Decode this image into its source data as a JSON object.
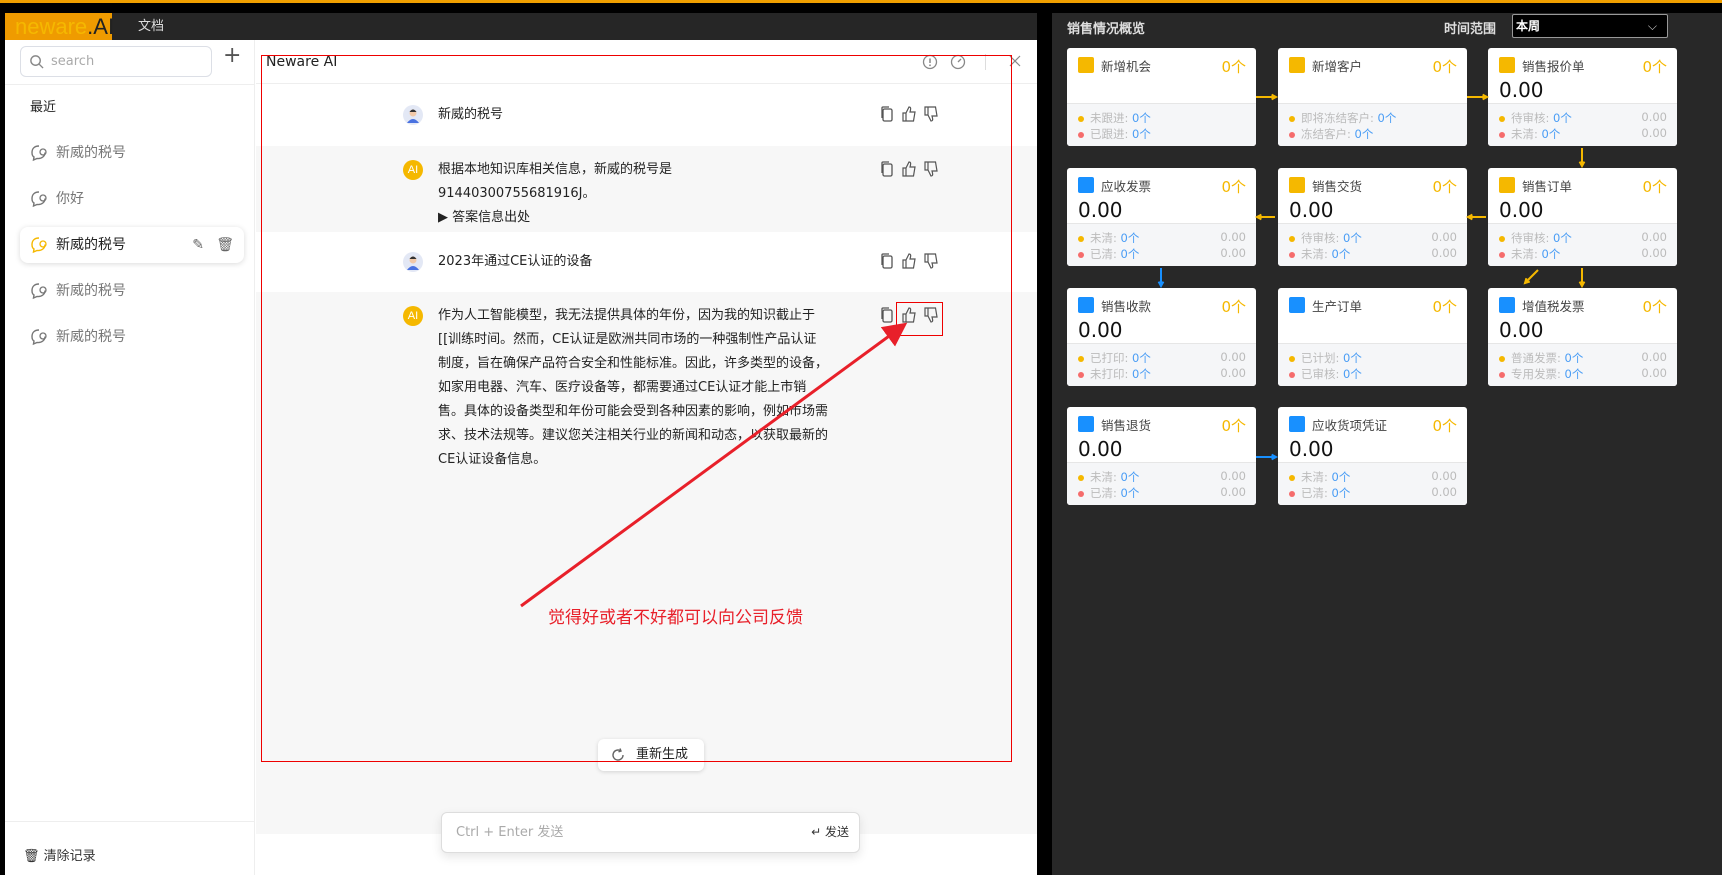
{
  "colors": {
    "accent": "#f0a000",
    "yellow": "#f5b800",
    "blue": "#1890ff",
    "annotation_red": "#e8202a",
    "link_blue": "#4a9df5"
  },
  "app": {
    "logo": {
      "part1": "neware",
      "part2": ".AI"
    },
    "nav_docs": "文档"
  },
  "sidebar": {
    "search_placeholder": "search",
    "recent_header": "最近",
    "items": [
      {
        "label": "新威的税号"
      },
      {
        "label": "你好"
      },
      {
        "label": "新威的税号",
        "active": true
      },
      {
        "label": "新威的税号"
      },
      {
        "label": "新威的税号"
      }
    ],
    "clear_label": "清除记录"
  },
  "chat": {
    "title": "Neware AI",
    "header_icons": [
      "info-icon",
      "clock-icon",
      "close-icon"
    ],
    "messages": [
      {
        "role": "user",
        "text": "新威的税号"
      },
      {
        "role": "ai",
        "avatar": "AI",
        "text": "根据本地知识库相关信息，新威的税号是91440300755681916J。",
        "source_toggle": "答案信息出处"
      },
      {
        "role": "user",
        "text": "2023年通过CE认证的设备"
      },
      {
        "role": "ai",
        "avatar": "AI",
        "text": "作为人工智能模型，我无法提供具体的年份，因为我的知识截止于[[训练时间。然而，CE认证是欧洲共同市场的一种强制性产品认证制度，旨在确保产品符合安全和性能标准。因此，许多类型的设备，如家用电器、汽车、医疗设备等，都需要通过CE认证才能上市销售。具体的设备类型和年份可能会受到各种因素的影响，例如市场需求、技术法规等。建议您关注相关行业的新闻和动态，以获取最新的CE认证设备信息。"
      }
    ],
    "regenerate_label": "重新生成",
    "input_placeholder": "Ctrl + Enter 发送",
    "send_label": "↵ 发送"
  },
  "annotation": {
    "text": "觉得好或者不好都可以向公司反馈"
  },
  "dashboard": {
    "title": "销售情况概览",
    "time_range_label": "时间范围",
    "time_range_value": "本周",
    "cards": [
      {
        "title": "新增机会",
        "count": "0个",
        "icon_color": "#f5b800",
        "lines": [
          {
            "label": "未跟进:",
            "value": "0个"
          },
          {
            "label": "已跟进:",
            "value": "0个"
          }
        ]
      },
      {
        "title": "新增客户",
        "count": "0个",
        "icon_color": "#f5b800",
        "lines": [
          {
            "label": "即将冻结客户:",
            "value": "0个"
          },
          {
            "label": "冻结客户:",
            "value": "0个"
          }
        ]
      },
      {
        "title": "销售报价单",
        "count": "0个",
        "amount": "0.00",
        "icon_color": "#f5b800",
        "lines": [
          {
            "label": "待审核:",
            "value": "0个",
            "amount": "0.00"
          },
          {
            "label": "未清:",
            "value": "0个",
            "amount": "0.00"
          }
        ]
      },
      {
        "title": "应收发票",
        "count": "0个",
        "amount": "0.00",
        "icon_color": "#1890ff",
        "lines": [
          {
            "label": "未清:",
            "value": "0个",
            "amount": "0.00"
          },
          {
            "label": "已清:",
            "value": "0个",
            "amount": "0.00"
          }
        ]
      },
      {
        "title": "销售交货",
        "count": "0个",
        "amount": "0.00",
        "icon_color": "#f5b800",
        "lines": [
          {
            "label": "待审核:",
            "value": "0个",
            "amount": "0.00"
          },
          {
            "label": "未清:",
            "value": "0个",
            "amount": "0.00"
          }
        ]
      },
      {
        "title": "销售订单",
        "count": "0个",
        "amount": "0.00",
        "icon_color": "#f5b800",
        "lines": [
          {
            "label": "待审核:",
            "value": "0个",
            "amount": "0.00"
          },
          {
            "label": "未清:",
            "value": "0个",
            "amount": "0.00"
          }
        ]
      },
      {
        "title": "销售收款",
        "count": "0个",
        "amount": "0.00",
        "icon_color": "#1890ff",
        "lines": [
          {
            "label": "已打印:",
            "value": "0个",
            "amount": "0.00"
          },
          {
            "label": "未打印:",
            "value": "0个",
            "amount": "0.00"
          }
        ]
      },
      {
        "title": "生产订单",
        "count": "0个",
        "icon_color": "#1890ff",
        "lines": [
          {
            "label": "已计划:",
            "value": "0个"
          },
          {
            "label": "已审核:",
            "value": "0个"
          }
        ]
      },
      {
        "title": "增值税发票",
        "count": "0个",
        "amount": "0.00",
        "icon_color": "#1890ff",
        "lines": [
          {
            "label": "普通发票:",
            "value": "0个",
            "amount": "0.00"
          },
          {
            "label": "专用发票:",
            "value": "0个",
            "amount": "0.00"
          }
        ]
      },
      {
        "title": "销售退货",
        "count": "0个",
        "amount": "0.00",
        "icon_color": "#1890ff",
        "lines": [
          {
            "label": "未清:",
            "value": "0个",
            "amount": "0.00"
          },
          {
            "label": "已清:",
            "value": "0个",
            "amount": "0.00"
          }
        ]
      },
      {
        "title": "应收货项凭证",
        "count": "0个",
        "amount": "0.00",
        "icon_color": "#1890ff",
        "lines": [
          {
            "label": "未清:",
            "value": "0个",
            "amount": "0.00"
          },
          {
            "label": "已清:",
            "value": "0个",
            "amount": "0.00"
          }
        ]
      }
    ]
  }
}
